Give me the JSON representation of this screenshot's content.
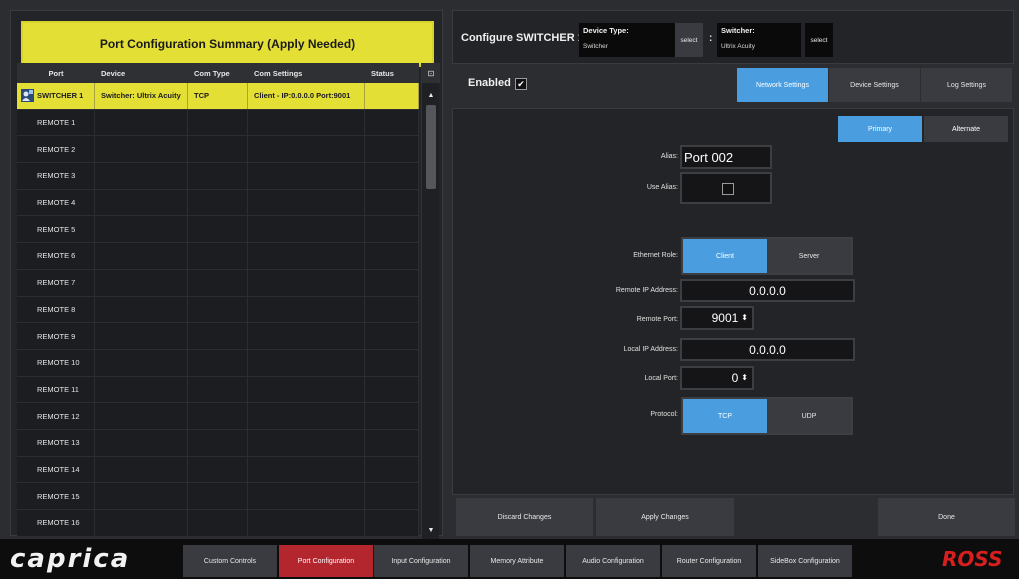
{
  "summary": {
    "title": "Port Configuration Summary (Apply Needed)",
    "columns": [
      "Port",
      "Device",
      "Com Type",
      "Com Settings",
      "Status"
    ],
    "rows": [
      {
        "port": "SWITCHER 1",
        "device": "Switcher: Ultrix Acuity",
        "comtype": "TCP",
        "comset": "Client - IP:0.0.0.0 Port:9001",
        "status": "",
        "selected": true
      },
      {
        "port": "REMOTE 1",
        "device": "",
        "comtype": "",
        "comset": "",
        "status": ""
      },
      {
        "port": "REMOTE 2",
        "device": "",
        "comtype": "",
        "comset": "",
        "status": ""
      },
      {
        "port": "REMOTE 3",
        "device": "",
        "comtype": "",
        "comset": "",
        "status": ""
      },
      {
        "port": "REMOTE 4",
        "device": "",
        "comtype": "",
        "comset": "",
        "status": ""
      },
      {
        "port": "REMOTE 5",
        "device": "",
        "comtype": "",
        "comset": "",
        "status": ""
      },
      {
        "port": "REMOTE 6",
        "device": "",
        "comtype": "",
        "comset": "",
        "status": ""
      },
      {
        "port": "REMOTE 7",
        "device": "",
        "comtype": "",
        "comset": "",
        "status": ""
      },
      {
        "port": "REMOTE 8",
        "device": "",
        "comtype": "",
        "comset": "",
        "status": ""
      },
      {
        "port": "REMOTE 9",
        "device": "",
        "comtype": "",
        "comset": "",
        "status": ""
      },
      {
        "port": "REMOTE 10",
        "device": "",
        "comtype": "",
        "comset": "",
        "status": ""
      },
      {
        "port": "REMOTE 11",
        "device": "",
        "comtype": "",
        "comset": "",
        "status": ""
      },
      {
        "port": "REMOTE 12",
        "device": "",
        "comtype": "",
        "comset": "",
        "status": ""
      },
      {
        "port": "REMOTE 13",
        "device": "",
        "comtype": "",
        "comset": "",
        "status": ""
      },
      {
        "port": "REMOTE 14",
        "device": "",
        "comtype": "",
        "comset": "",
        "status": ""
      },
      {
        "port": "REMOTE 15",
        "device": "",
        "comtype": "",
        "comset": "",
        "status": ""
      },
      {
        "port": "REMOTE 16",
        "device": "",
        "comtype": "",
        "comset": "",
        "status": ""
      }
    ]
  },
  "configure": {
    "title": "Configure SWITCHER 1:",
    "device_type_label": "Device Type:",
    "device_type_value": "Switcher",
    "switcher_label": "Switcher:",
    "switcher_value": "Ultrix Acuity",
    "select_label": "select",
    "colon": ":"
  },
  "enabled": {
    "label": "Enabled",
    "checked": true,
    "check_glyph": "✔"
  },
  "tabs": [
    "Network Settings",
    "Device Settings",
    "Log Settings"
  ],
  "active_tab": "Network Settings",
  "primary_alternate": [
    "Primary",
    "Alternate"
  ],
  "form": {
    "alias_label": "Alias:",
    "alias_value": "Port 002",
    "use_alias_label": "Use Alias:",
    "ethernet_role_label": "Ethernet Role:",
    "ethernet_roles": [
      "Client",
      "Server"
    ],
    "remote_ip_label": "Remote IP Address:",
    "remote_ip_value": "0.0.0.0",
    "remote_port_label": "Remote Port:",
    "remote_port_value": "9001",
    "local_ip_label": "Local IP Address:",
    "local_ip_value": "0.0.0.0",
    "local_port_label": "Local Port:",
    "local_port_value": "0",
    "protocol_label": "Protocol:",
    "protocols": [
      "TCP",
      "UDP"
    ]
  },
  "actions": {
    "discard": "Discard Changes",
    "apply": "Apply Changes",
    "done": "Done"
  },
  "footer": {
    "logo": "caprica",
    "brand": "ROSS",
    "nav": [
      "Custom Controls",
      "Port Configuration",
      "Input Configuration",
      "Memory Attribute",
      "Audio Configuration",
      "Router Configuration",
      "SideBox Configuration"
    ],
    "active": "Port Configuration"
  },
  "colors": {
    "accent": "#4a9ee0",
    "highlight": "#e4df35",
    "active_nav": "#b3262d",
    "brand": "#d81f1f"
  },
  "icons": {
    "row_icon": "user-port-icon",
    "scroll_up": "arrow-up-icon",
    "scroll_down": "arrow-down-icon",
    "column_menu": "column-settings-icon"
  }
}
